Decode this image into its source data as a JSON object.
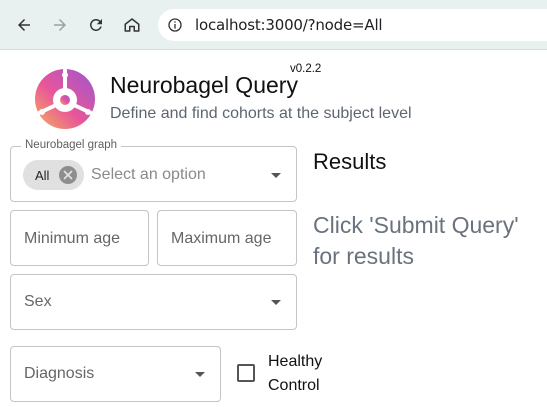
{
  "browser": {
    "url": "localhost:3000/?node=All",
    "icons": [
      "back-icon",
      "forward-icon",
      "reload-icon",
      "home-icon",
      "site-info-icon"
    ]
  },
  "header": {
    "title": "Neurobagel Query",
    "version": "v0.2.2",
    "subtitle": "Define and find cohorts at the subject level"
  },
  "form": {
    "graph": {
      "legend": "Neurobagel graph",
      "selected_chip": "All",
      "placeholder": "Select an option"
    },
    "min_age": {
      "placeholder": "Minimum age"
    },
    "max_age": {
      "placeholder": "Maximum age"
    },
    "sex": {
      "placeholder": "Sex"
    },
    "diagnosis": {
      "placeholder": "Diagnosis"
    },
    "healthy_control": {
      "label": "Healthy Control",
      "checked": false
    }
  },
  "results": {
    "title": "Results",
    "message": "Click 'Submit Query' for results"
  },
  "colors": {
    "chrome_bg": "#e8f1ef",
    "muted_text": "#6a737d",
    "border": "#c4c4c4",
    "logo_pink": "#e0489a",
    "logo_orange": "#f4a25a",
    "logo_purple": "#a455c9"
  }
}
